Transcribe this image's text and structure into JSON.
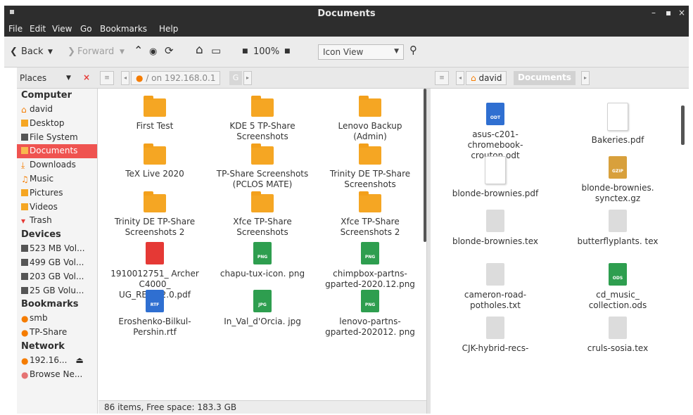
{
  "window": {
    "title": "Documents"
  },
  "menubar": [
    "File",
    "Edit",
    "View",
    "Go",
    "Bookmarks",
    "Help"
  ],
  "toolbar": {
    "back": "Back",
    "forward": "Forward",
    "zoom": "100%",
    "view_mode": "Icon View"
  },
  "left_path": {
    "places_label": "Places",
    "location": "/ on 192.168.0.1",
    "segment": "G"
  },
  "right_path": {
    "home": "david",
    "current": "Documents"
  },
  "sidebar": {
    "computer_head": "Computer",
    "computer": [
      "david",
      "Desktop",
      "File System",
      "Documents",
      "Downloads",
      "Music",
      "Pictures",
      "Videos",
      "Trash"
    ],
    "devices_head": "Devices",
    "devices": [
      "523 MB Vol...",
      "499 GB Vol...",
      "203 GB Vol...",
      "25 GB Volu..."
    ],
    "bookmarks_head": "Bookmarks",
    "bookmarks": [
      "smb",
      "TP-Share"
    ],
    "network_head": "Network",
    "network": [
      "192.16...",
      "Browse Ne..."
    ]
  },
  "left_items": [
    {
      "label": "First Test",
      "kind": "folder"
    },
    {
      "label": "KDE 5 TP-Share Screenshots",
      "kind": "folder"
    },
    {
      "label": "Lenovo Backup (Admin)",
      "kind": "folder"
    },
    {
      "label": "TeX Live 2020",
      "kind": "folder"
    },
    {
      "label": "TP-Share Screenshots (PCLOS MATE)",
      "kind": "folder"
    },
    {
      "label": "Trinity DE TP-Share Screenshots",
      "kind": "folder"
    },
    {
      "label": "Trinity DE TP-Share Screenshots 2",
      "kind": "folder"
    },
    {
      "label": "Xfce TP-Share Screenshots",
      "kind": "folder"
    },
    {
      "label": "Xfce TP-Share Screenshots 2",
      "kind": "folder"
    },
    {
      "label": "1910012751_ Archer C4000_ UG_REV3.2.0.pdf",
      "kind": "pdf"
    },
    {
      "label": "chapu-tux-icon. png",
      "kind": "png",
      "tag": "PNG"
    },
    {
      "label": "chimpbox-partns-gparted-2020.12.png",
      "kind": "png",
      "tag": "PNG"
    },
    {
      "label": "Eroshenko-Bilkul-Pershin.rtf",
      "kind": "rtf",
      "tag": "RTF"
    },
    {
      "label": "In_Val_d'Orcia. jpg",
      "kind": "png",
      "tag": "JPG"
    },
    {
      "label": "lenovo-partns-gparted-202012. png",
      "kind": "png",
      "tag": "PNG"
    }
  ],
  "right_items": [
    {
      "label": "asus-c201-chromebook-crouton.odt",
      "kind": "odt",
      "tag": "ODT"
    },
    {
      "label": "Bakeries.pdf",
      "kind": "doc"
    },
    {
      "label": "blonde-brownies.pdf",
      "kind": "doc"
    },
    {
      "label": "blonde-brownies. synctex.gz",
      "kind": "gz",
      "tag": "GZIP"
    },
    {
      "label": "blonde-brownies.tex",
      "kind": "gray"
    },
    {
      "label": "butterflyplants. tex",
      "kind": "gray"
    },
    {
      "label": "cameron-road-potholes.txt",
      "kind": "gray"
    },
    {
      "label": "cd_music_ collection.ods",
      "kind": "ods",
      "tag": "ODS"
    },
    {
      "label": "CJK-hybrid-recs-",
      "kind": "gray"
    },
    {
      "label": "cruls-sosia.tex",
      "kind": "gray"
    }
  ],
  "status": "86 items, Free space: 183.3 GB",
  "colors": {
    "accent": "#ef5350",
    "folder": "#f5a623",
    "titlebar": "#2d2d2d"
  }
}
